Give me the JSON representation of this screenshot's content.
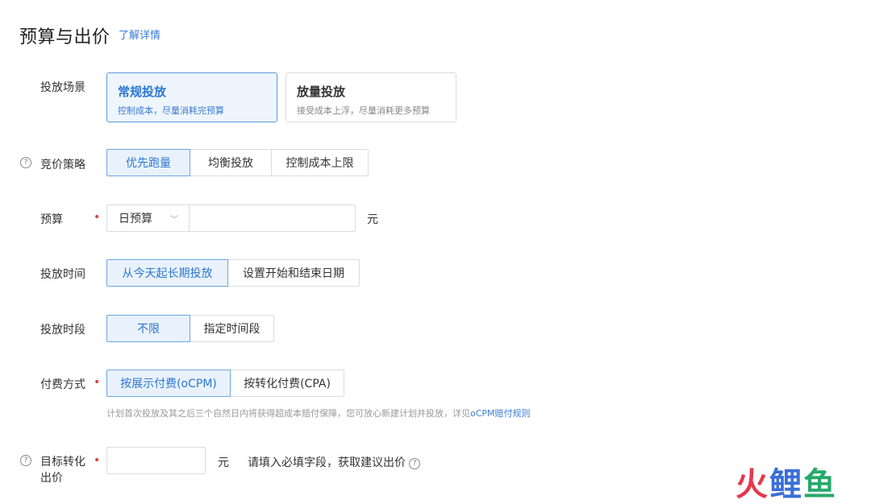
{
  "header": {
    "title": "预算与出价",
    "learn_more": "了解详情"
  },
  "scene": {
    "label": "投放场景",
    "options": [
      {
        "title": "常规投放",
        "desc": "控制成本，尽量消耗完预算",
        "active": true
      },
      {
        "title": "放量投放",
        "desc": "接受成本上浮，尽量消耗更多预算",
        "active": false
      }
    ]
  },
  "bid_strategy": {
    "label": "竞价策略",
    "options": [
      "优先跑量",
      "均衡投放",
      "控制成本上限"
    ],
    "selected": "优先跑量"
  },
  "budget": {
    "label": "预算",
    "type_selected": "日预算",
    "value": "",
    "unit": "元"
  },
  "schedule_time": {
    "label": "投放时间",
    "options": [
      "从今天起长期投放",
      "设置开始和结束日期"
    ],
    "selected": "从今天起长期投放"
  },
  "schedule_period": {
    "label": "投放时段",
    "options": [
      "不限",
      "指定时间段"
    ],
    "selected": "不限"
  },
  "payment": {
    "label": "付费方式",
    "options": [
      "按展示付费(oCPM)",
      "按转化付费(CPA)"
    ],
    "selected": "按展示付费(oCPM)",
    "hint_text": "计划首次投放及其之后三个自然日内将获得超成本赔付保障，您可放心新建计划并投放，详见",
    "hint_link": "oCPM赔付规则"
  },
  "target_bid": {
    "label_line1": "目标转化",
    "label_line2": "出价",
    "value": "",
    "unit": "元",
    "suggest_text": "请填入必填字段，获取建议出价"
  },
  "watermark": {
    "char1": "火",
    "char2": "鲤",
    "char3": "鱼"
  }
}
